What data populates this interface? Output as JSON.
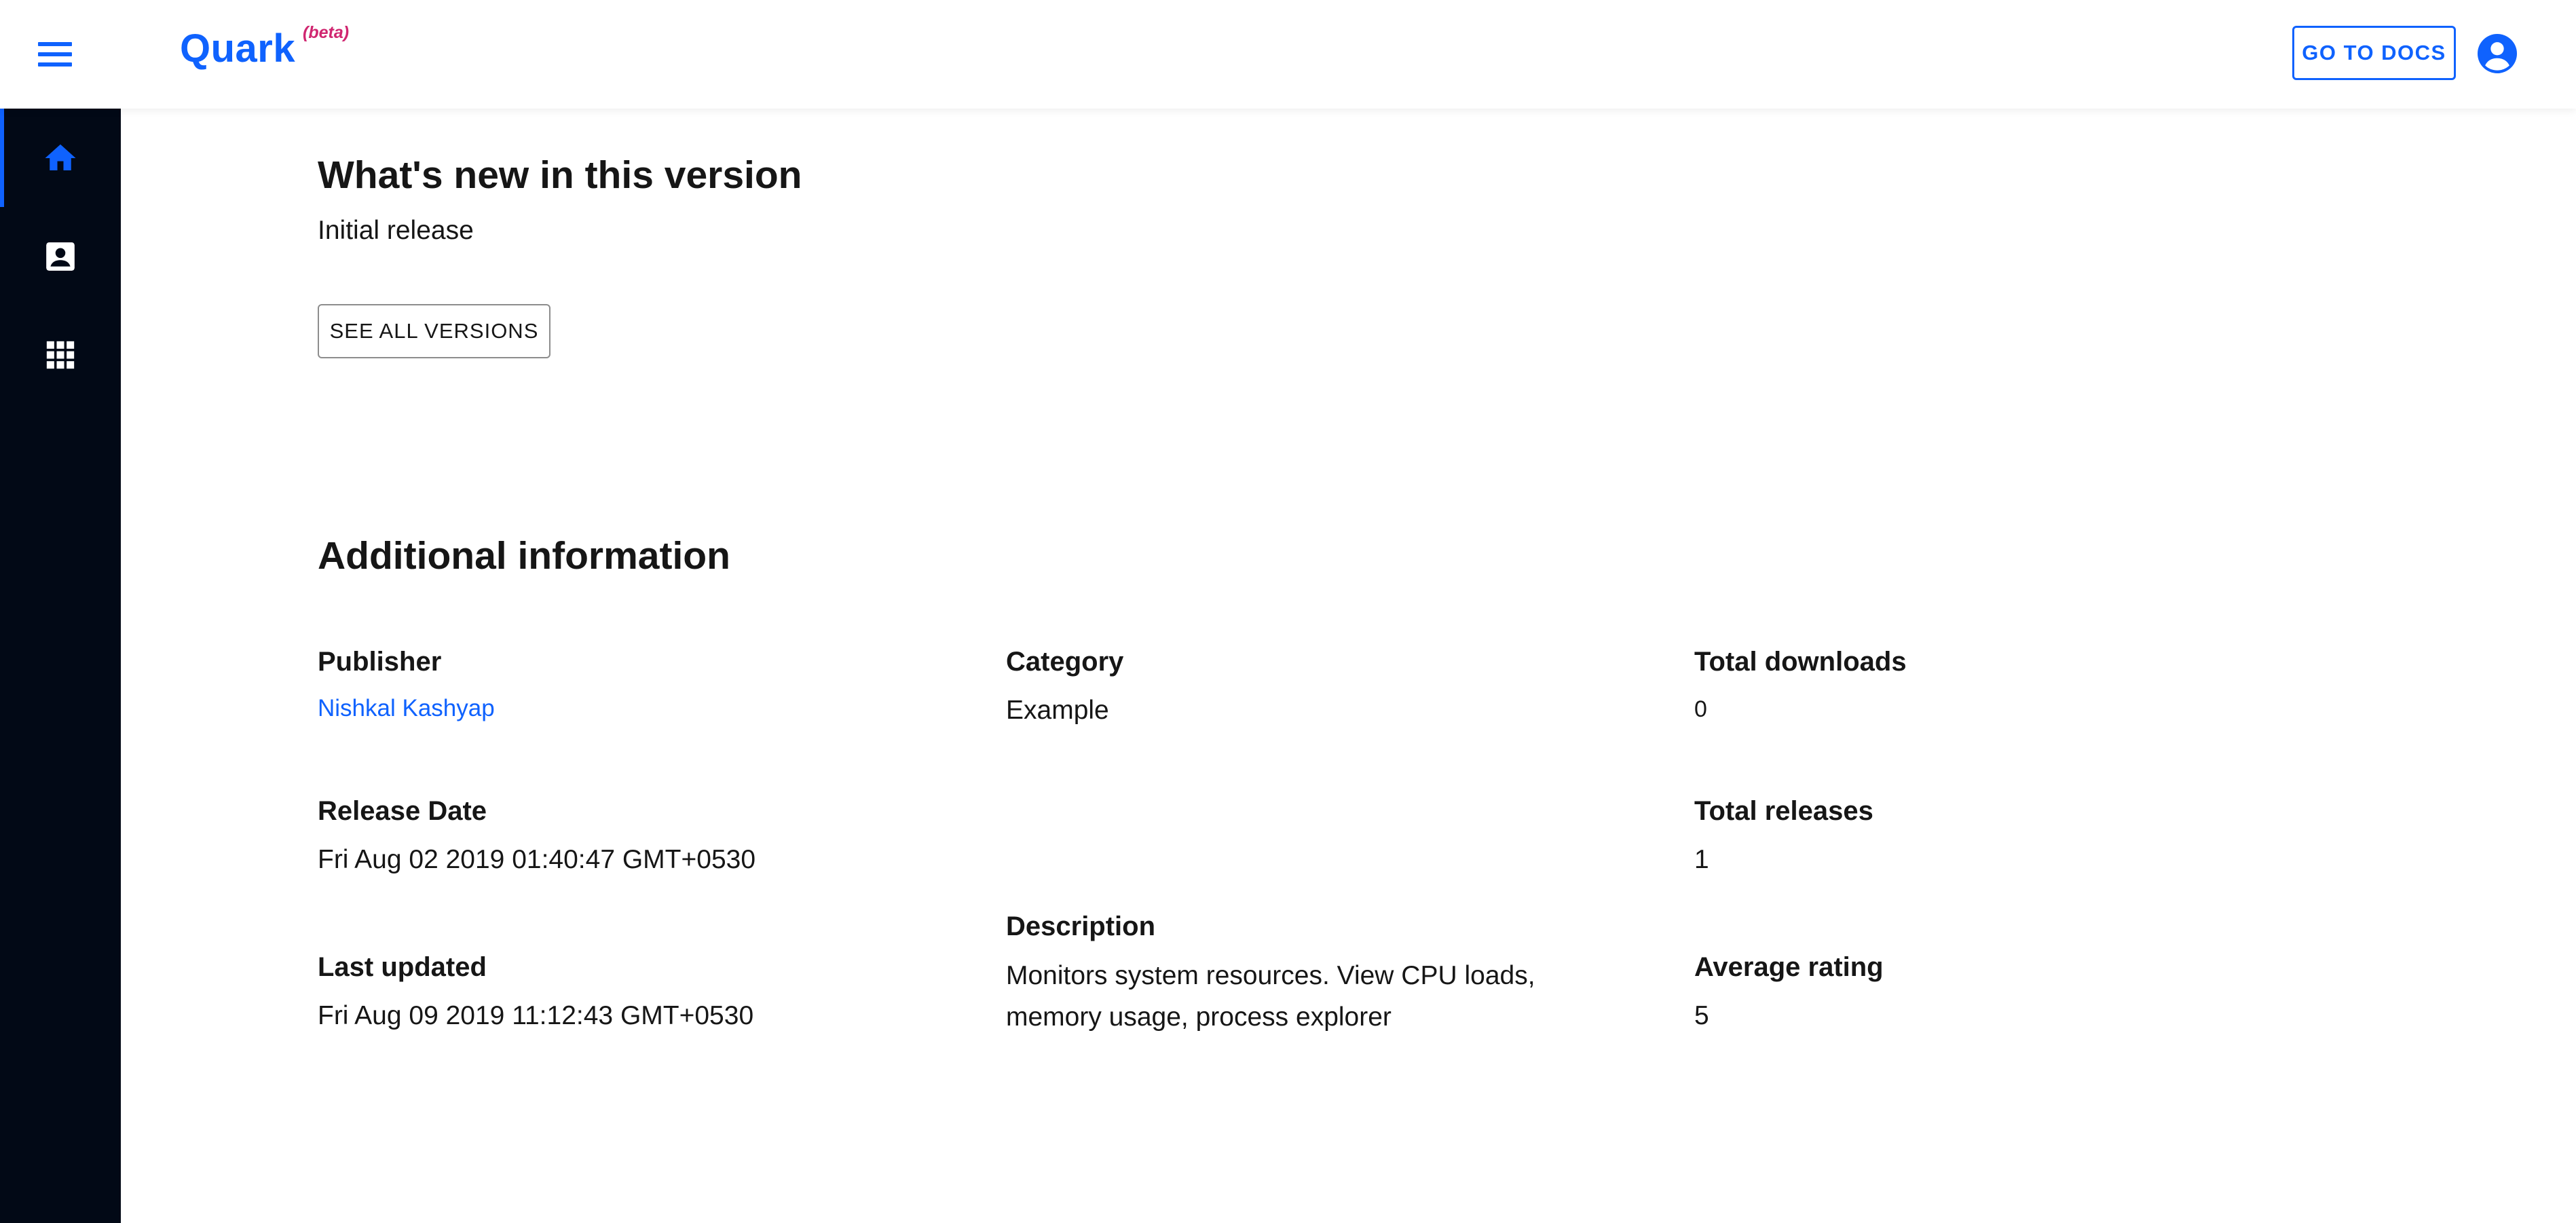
{
  "header": {
    "menu_icon": "menu-icon",
    "brand": "Quark",
    "beta": "(beta)",
    "docs_button": "GO TO DOCS",
    "avatar_icon": "account-circle-icon",
    "accent_color": "#0f62fe",
    "beta_color": "#d02670"
  },
  "sidebar": {
    "background": "#020916",
    "items": [
      {
        "icon": "home-icon",
        "active": true
      },
      {
        "icon": "contact-card-icon",
        "active": false
      },
      {
        "icon": "apps-grid-icon",
        "active": false
      }
    ]
  },
  "whats_new": {
    "title": "What's new in this version",
    "text": "Initial release",
    "button": "SEE ALL VERSIONS"
  },
  "additional": {
    "title": "Additional information",
    "publisher_label": "Publisher",
    "publisher_value": "Nishkal Kashyap",
    "category_label": "Category",
    "category_value": "Example",
    "downloads_label": "Total downloads",
    "downloads_value": "0",
    "release_date_label": "Release Date",
    "release_date_value": "Fri Aug 02 2019 01:40:47 GMT+0530",
    "releases_label": "Total releases",
    "releases_value": "1",
    "description_label": "Description",
    "description_value": "Monitors system resources. View CPU loads, memory usage, process explorer",
    "last_updated_label": "Last updated",
    "last_updated_value": "Fri Aug 09 2019 11:12:43 GMT+0530",
    "rating_label": "Average rating",
    "rating_value": "5"
  }
}
